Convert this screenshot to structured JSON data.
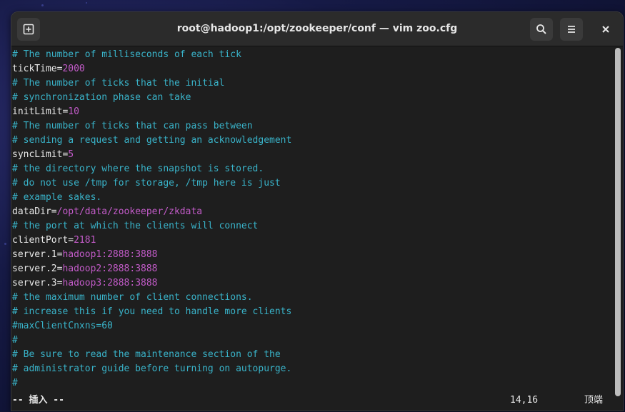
{
  "window": {
    "title": "root@hadoop1:/opt/zookeeper/conf — vim zoo.cfg",
    "new_tab_icon": "new-tab-icon",
    "search_icon": "search-icon",
    "menu_icon": "hamburger-menu-icon",
    "close_icon": "close-icon"
  },
  "editor": {
    "lines": [
      {
        "type": "comment",
        "text": "# The number of milliseconds of each tick"
      },
      {
        "type": "kv",
        "key": "tickTime=",
        "value": "2000"
      },
      {
        "type": "comment",
        "text": "# The number of ticks that the initial"
      },
      {
        "type": "comment",
        "text": "# synchronization phase can take"
      },
      {
        "type": "kv",
        "key": "initLimit=",
        "value": "10"
      },
      {
        "type": "comment",
        "text": "# The number of ticks that can pass between"
      },
      {
        "type": "comment",
        "text": "# sending a request and getting an acknowledgement"
      },
      {
        "type": "kv",
        "key": "syncLimit=",
        "value": "5"
      },
      {
        "type": "comment",
        "text": "# the directory where the snapshot is stored."
      },
      {
        "type": "comment",
        "text": "# do not use /tmp for storage, /tmp here is just"
      },
      {
        "type": "comment",
        "text": "# example sakes."
      },
      {
        "type": "kv",
        "key": "dataDir=",
        "value": "/opt/data/zookeeper/zkdata"
      },
      {
        "type": "comment",
        "text": "# the port at which the clients will connect"
      },
      {
        "type": "kv",
        "key": "clientPort=",
        "value": "2181"
      },
      {
        "type": "kv",
        "key": "server.1=",
        "value": "hadoop1:2888:3888"
      },
      {
        "type": "kv",
        "key": "server.2=",
        "value": "hadoop2:2888:3888"
      },
      {
        "type": "kv",
        "key": "server.3=",
        "value": "hadoop3:2888:3888"
      },
      {
        "type": "comment",
        "text": "# the maximum number of client connections."
      },
      {
        "type": "comment",
        "text": "# increase this if you need to handle more clients"
      },
      {
        "type": "comment",
        "text": "#maxClientCnxns=60"
      },
      {
        "type": "comment",
        "text": "#"
      },
      {
        "type": "comment",
        "text": "# Be sure to read the maintenance section of the"
      },
      {
        "type": "comment",
        "text": "# administrator guide before turning on autopurge."
      },
      {
        "type": "comment",
        "text": "#"
      }
    ],
    "mode": "-- 插入 --",
    "cursor_position": "14,16",
    "scroll_position": "顶端"
  },
  "colors": {
    "comment": "#39b3c9",
    "value": "#c25bc8",
    "text": "#e8e8e8",
    "background": "#1e1e1e",
    "titlebar": "#2b2b2b"
  }
}
